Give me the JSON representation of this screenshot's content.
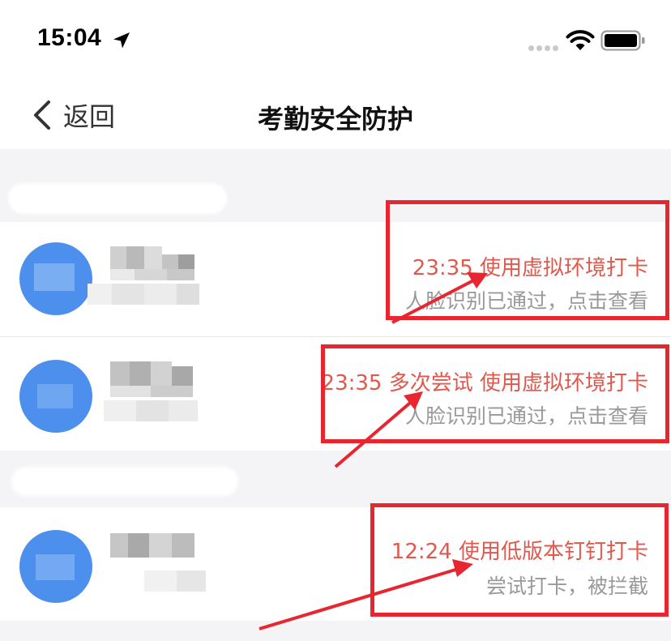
{
  "status_bar": {
    "time": "15:04",
    "icons": [
      "location-arrow-icon",
      "signal-dots-icon",
      "wifi-icon",
      "battery-icon"
    ]
  },
  "nav": {
    "back_label": "返回",
    "title": "考勤安全防护"
  },
  "records": [
    {
      "status": "23:35 使用虚拟环境打卡",
      "detail": "人脸识别已通过，点击查看",
      "name": "",
      "subtitle": ""
    },
    {
      "status": "23:35 多次尝试 使用虚拟环境打卡",
      "detail": "人脸识别已通过，点击查看",
      "name": "",
      "subtitle": ""
    },
    {
      "status": "12:24 使用低版本钉钉打卡",
      "detail": "尝试打卡，被拦截",
      "name": "",
      "subtitle": ""
    }
  ],
  "colors": {
    "status_text": "#e2584c",
    "detail_text": "#999999",
    "avatar": "#4d8fec",
    "annotation": "#e8262f",
    "section_bg": "#f4f4f6"
  }
}
